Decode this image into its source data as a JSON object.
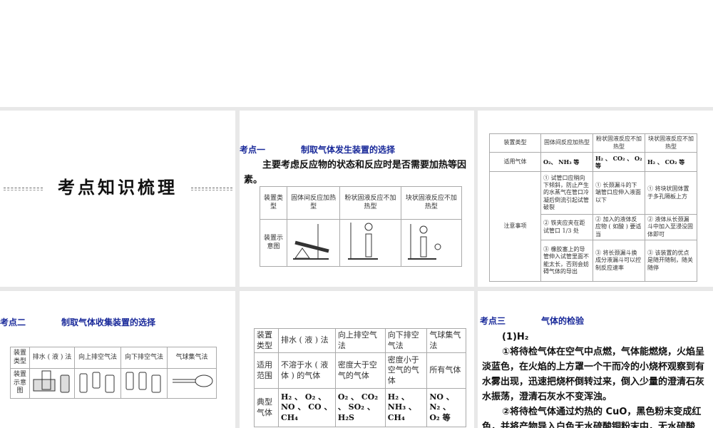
{
  "slide1": {
    "title": "考点知识梳理"
  },
  "slide2": {
    "heading_no": "考点一",
    "heading": "制取气体发生装置的选择",
    "intro": "主要考虑反应物的状态和反应时是否需要加热等因素。",
    "headers": [
      "装置类型",
      "固体间反应加热型",
      "粉状固液反应不加热型",
      "块状固液反应不加热型"
    ],
    "row_label": "装置示意图"
  },
  "slide3": {
    "headers": [
      "装置类型",
      "固体间反应加热型",
      "粉状固液反应不加热型",
      "块状固液反应不加热型"
    ],
    "gas_label": "适用气体",
    "gases": [
      "O₂、 NH₃ 等",
      "H₂ 、 CO₂ 、 O₂ 等",
      "H₂ 、 CO₂ 等"
    ],
    "note_label": "注意事项",
    "notes": [
      [
        "① 试管口应稍向下倾斜，防止产生的水蒸气在管口冷凝后倒流引起试管破裂",
        "① 长颈漏斗的下端管口应伸入液面以下",
        "① 将块状固体置于多孔隔板上方"
      ],
      [
        "② 铁夹应夹在距试管口 1/3 处",
        "② 加入的液体反应物 ( 如酸 ) 要适当",
        "② 液体从长颈漏斗中加入至浸没固体即可"
      ],
      [
        "③ 橡胶塞上的导管伸入试管里面不能太长，否则会妨碍气体的导出",
        "③ 将长颈漏斗换成分液漏斗可以控制反应速率",
        "③ 该装置的优点是随开随制，随关随停"
      ]
    ]
  },
  "slide4": {
    "heading_no": "考点二",
    "heading": "制取气体收集装置的选择",
    "headers": [
      "装置类型",
      "排水 ( 液 ) 法",
      "向上排空气法",
      "向下排空气法",
      "气球集气法"
    ],
    "row_label": "装置示意图"
  },
  "slide5": {
    "rows": [
      [
        "装置类型",
        "排水 ( 液 ) 法",
        "向上排空气法",
        "向下排空气法",
        "气球集气法"
      ],
      [
        "适用范围",
        "不溶于水 ( 液体 ) 的气体",
        "密度大于空气的气体",
        "密度小于空气的气体",
        "所有气体"
      ],
      [
        "典型气体",
        "H₂ 、 O₂ 、 NO 、 CO 、 CH₄",
        "O₂ 、 CO₂ 、 SO₂ 、 H₂S",
        "H₂ 、 NH₃ 、 CH₄",
        "NO 、 N₂ 、 O₂ 等"
      ]
    ]
  },
  "slide6": {
    "heading_no": "考点三",
    "heading": "气体的检验",
    "sub": "(1)H₂",
    "p1": "①将待检气体在空气中点燃，气体能燃烧，火焰呈淡蓝色，在火焰的上方罩一个干而冷的小烧杯观察到有水雾出现，迅速把烧杯倒转过来，倒入少量的澄清石灰水振荡，澄清石灰水不变浑浊。",
    "p2": "②将待检气体通过灼热的 CuO，黑色粉末变成红色，并将产物导入白色无水硫酸铜粉末中，无水硫酸"
  }
}
